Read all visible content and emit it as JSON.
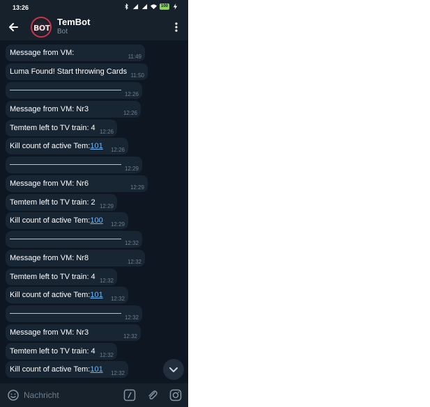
{
  "status_bar": {
    "time": "13:26",
    "battery": "100",
    "icons": [
      "bluetooth-icon",
      "signal-icon",
      "signal-icon",
      "wifi-icon",
      "battery-icon",
      "charging-icon"
    ]
  },
  "header": {
    "title": "TemBot",
    "subtitle": "Bot",
    "avatar_text": "BOT",
    "icons": [
      "back-arrow-icon",
      "more-vert-icon"
    ]
  },
  "messages": [
    {
      "text": "Message from VM:",
      "time": "11:49"
    },
    {
      "text": "Luma Found! Start throwing Cards",
      "time": "11:50"
    },
    {
      "text": "",
      "separator": true,
      "time": "12:26"
    },
    {
      "text": "Message from VM: Nr3",
      "time": "12:26"
    },
    {
      "text": "Temtem left to TV train: 4",
      "time": "12:26"
    },
    {
      "text": "Kill count of active Tem: ",
      "link": "101",
      "time": "12:26"
    },
    {
      "text": "",
      "separator": true,
      "time": "12:29"
    },
    {
      "text": "Message from VM: Nr6",
      "time": "12:29"
    },
    {
      "text": "Temtem left to TV train: 2",
      "time": "12:29"
    },
    {
      "text": "Kill count of active Tem: ",
      "link": "100",
      "time": "12:29"
    },
    {
      "text": "",
      "separator": true,
      "time": "12:32"
    },
    {
      "text": "Message from VM: Nr8",
      "time": "12:32"
    },
    {
      "text": "Temtem left to TV train: 4",
      "time": "12:32"
    },
    {
      "text": "Kill count of active Tem: ",
      "link": "101",
      "time": "12:32"
    },
    {
      "text": "",
      "separator": true,
      "time": "12:32"
    },
    {
      "text": "Message from VM: Nr3",
      "time": "12:32"
    },
    {
      "text": "Temtem left to TV train: 4",
      "time": "12:32"
    },
    {
      "text": "Kill count of active Tem: ",
      "link": "101",
      "time": "12:32"
    }
  ],
  "input_bar": {
    "placeholder": "Nachricht",
    "icons": [
      "emoji-icon",
      "slash-command-icon",
      "attach-icon",
      "camera-icon"
    ]
  },
  "colors": {
    "background": "#0e1621",
    "header": "#17212b",
    "bubble": "#182533",
    "link": "#71baf7",
    "time": "#6d7f8f"
  }
}
